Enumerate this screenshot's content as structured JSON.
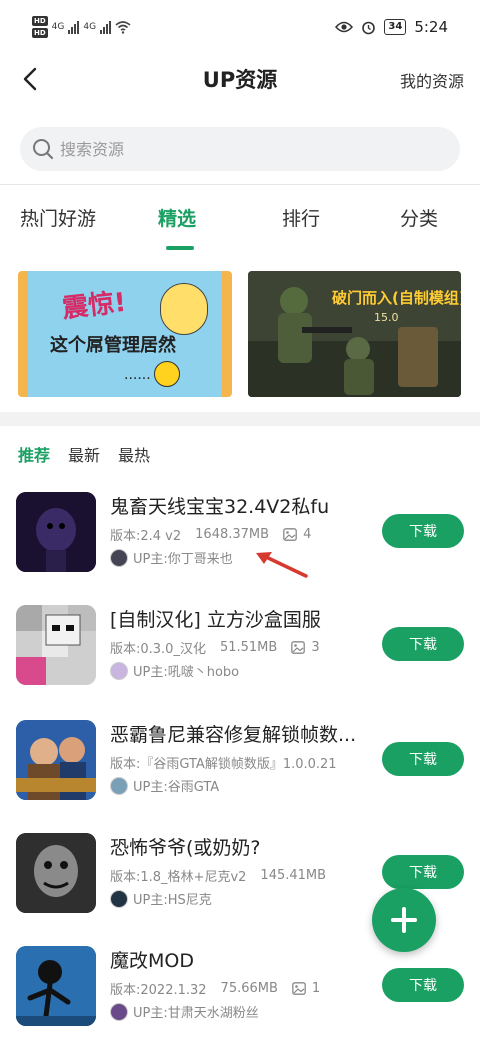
{
  "status_bar": {
    "network_1": "4G",
    "network_2": "4G",
    "battery": "34",
    "time": "5:24"
  },
  "header": {
    "title": "UP资源",
    "right_link": "我的资源"
  },
  "search": {
    "placeholder": "搜索资源"
  },
  "tabs": [
    {
      "label": "热门好游",
      "active": false
    },
    {
      "label": "精选",
      "active": true
    },
    {
      "label": "排行",
      "active": false
    },
    {
      "label": "分类",
      "active": false
    }
  ],
  "banners": [
    {
      "title": "震惊!",
      "subtitle": "这个屌管理居然",
      "dots": "......"
    },
    {
      "title": "破门而入(自制模组)",
      "version": "15.0"
    }
  ],
  "subtabs": [
    {
      "label": "推荐",
      "active": true
    },
    {
      "label": "最新",
      "active": false
    },
    {
      "label": "最热",
      "active": false
    }
  ],
  "items": [
    {
      "name": "鬼畜天线宝宝32.4V2私fu",
      "version": "版本:2.4 v2",
      "size": "1648.37MB",
      "images": "4",
      "uploader": "UP主:你丁哥来也",
      "button": "下载"
    },
    {
      "name": "[自制汉化] 立方沙盒国服",
      "version": "版本:0.3.0_汉化",
      "size": "51.51MB",
      "images": "3",
      "uploader": "UP主:吼啵丶hobo",
      "button": "下载"
    },
    {
      "name": "恶霸鲁尼兼容修复解锁帧数...",
      "version": "版本:『谷雨GTA解锁帧数版』1.0.0.21",
      "size": "",
      "images": "",
      "uploader": "UP主:谷雨GTA",
      "button": "下载"
    },
    {
      "name": "恐怖爷爷(或奶奶?",
      "version": "版本:1.8_格林+尼克v2",
      "size": "145.41MB",
      "images": "",
      "uploader": "UP主:HS尼克",
      "button": "下载"
    },
    {
      "name": "魔改MOD",
      "version": "版本:2022.1.32",
      "size": "75.66MB",
      "images": "1",
      "uploader": "UP主:甘肃天水湖粉丝",
      "button": "下载"
    }
  ],
  "colors": {
    "accent": "#1aa063",
    "annotation_arrow": "#d63a2f"
  }
}
